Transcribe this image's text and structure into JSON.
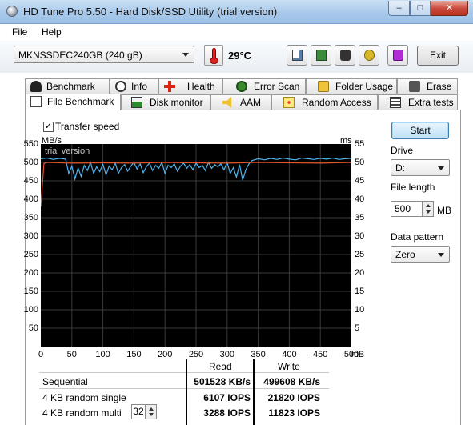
{
  "window": {
    "title": "HD Tune Pro 5.50 - Hard Disk/SSD Utility (trial version)",
    "minimize": "–",
    "maximize": "□",
    "close": "✕"
  },
  "menu": {
    "file": "File",
    "help": "Help"
  },
  "toolbar": {
    "drive": "MKNSSDEC240GB (240 gB)",
    "temperature": "29°C",
    "exit": "Exit"
  },
  "tabs_row1": [
    "Benchmark",
    "Info",
    "Health",
    "Error Scan",
    "Folder Usage",
    "Erase"
  ],
  "tabs_row2": [
    "File Benchmark",
    "Disk monitor",
    "AAM",
    "Random Access",
    "Extra tests"
  ],
  "active_tab": "File Benchmark",
  "options": {
    "transfer_speed_label": "Transfer speed",
    "transfer_speed_checked": true,
    "start": "Start",
    "drive_label": "Drive",
    "drive_value": "D:",
    "file_length_label": "File length",
    "file_length_value": "500",
    "file_length_unit": "MB",
    "data_pattern_label": "Data pattern",
    "data_pattern_value": "Zero"
  },
  "chart_data": {
    "type": "line",
    "watermark": "trial version",
    "ylabel_left": "MB/s",
    "ylabel_right": "ms",
    "xlabel": "mB",
    "xlim": [
      0,
      500
    ],
    "ylim_left": [
      0,
      550
    ],
    "ylim_right": [
      0,
      55
    ],
    "yticks_left": [
      "550",
      "500",
      "450",
      "400",
      "350",
      "300",
      "250",
      "200",
      "150",
      "100",
      "50"
    ],
    "yticks_right": [
      "55",
      "50",
      "45",
      "40",
      "35",
      "30",
      "25",
      "20",
      "15",
      "10",
      "5"
    ],
    "xticks": [
      "0",
      "50",
      "100",
      "150",
      "200",
      "250",
      "300",
      "350",
      "400",
      "450",
      "500"
    ],
    "grid": true,
    "series": [
      {
        "color": "#4fb3ee",
        "x": [
          0,
          10,
          20,
          30,
          40,
          45,
          50,
          55,
          60,
          65,
          70,
          75,
          80,
          85,
          90,
          95,
          100,
          105,
          110,
          115,
          120,
          125,
          130,
          135,
          140,
          145,
          150,
          155,
          160,
          165,
          170,
          175,
          180,
          185,
          190,
          195,
          200,
          205,
          210,
          215,
          220,
          225,
          230,
          235,
          240,
          245,
          250,
          255,
          260,
          265,
          270,
          275,
          280,
          285,
          290,
          295,
          300,
          305,
          310,
          315,
          320,
          325,
          330,
          335,
          340,
          350,
          360,
          370,
          380,
          390,
          400,
          410,
          420,
          430,
          440,
          450,
          460,
          470,
          480,
          490,
          500
        ],
        "y": [
          510,
          512,
          508,
          511,
          509,
          470,
          490,
          455,
          485,
          462,
          492,
          478,
          500,
          470,
          488,
          475,
          495,
          466,
          490,
          480,
          498,
          470,
          486,
          494,
          476,
          490,
          500,
          482,
          496,
          472,
          488,
          498,
          478,
          492,
          484,
          500,
          470,
          492,
          486,
          496,
          476,
          490,
          498,
          484,
          494,
          480,
          498,
          486,
          492,
          478,
          500,
          484,
          494,
          488,
          496,
          480,
          500,
          470,
          486,
          460,
          494,
          452,
          480,
          496,
          505,
          510,
          507,
          511,
          508,
          512,
          509,
          507,
          512,
          510,
          508,
          511,
          509,
          512,
          508,
          510,
          511
        ]
      },
      {
        "color": "#e0552a",
        "x": [
          0,
          5,
          10,
          50,
          100,
          150,
          200,
          250,
          300,
          350,
          400,
          450,
          500
        ],
        "y": [
          380,
          497,
          500,
          498,
          499,
          498,
          500,
          499,
          498,
          500,
          499,
          498,
          500
        ]
      }
    ]
  },
  "results": {
    "headers": {
      "read": "Read",
      "write": "Write"
    },
    "rows": [
      {
        "label": "Sequential",
        "read": "501528 KB/s",
        "write": "499608 KB/s"
      },
      {
        "label": "4 KB random single",
        "read": "6107 IOPS",
        "write": "21820 IOPS"
      },
      {
        "label": "4 KB random multi",
        "read": "3288 IOPS",
        "write": "11823 IOPS"
      }
    ],
    "queue_depth": "32"
  }
}
